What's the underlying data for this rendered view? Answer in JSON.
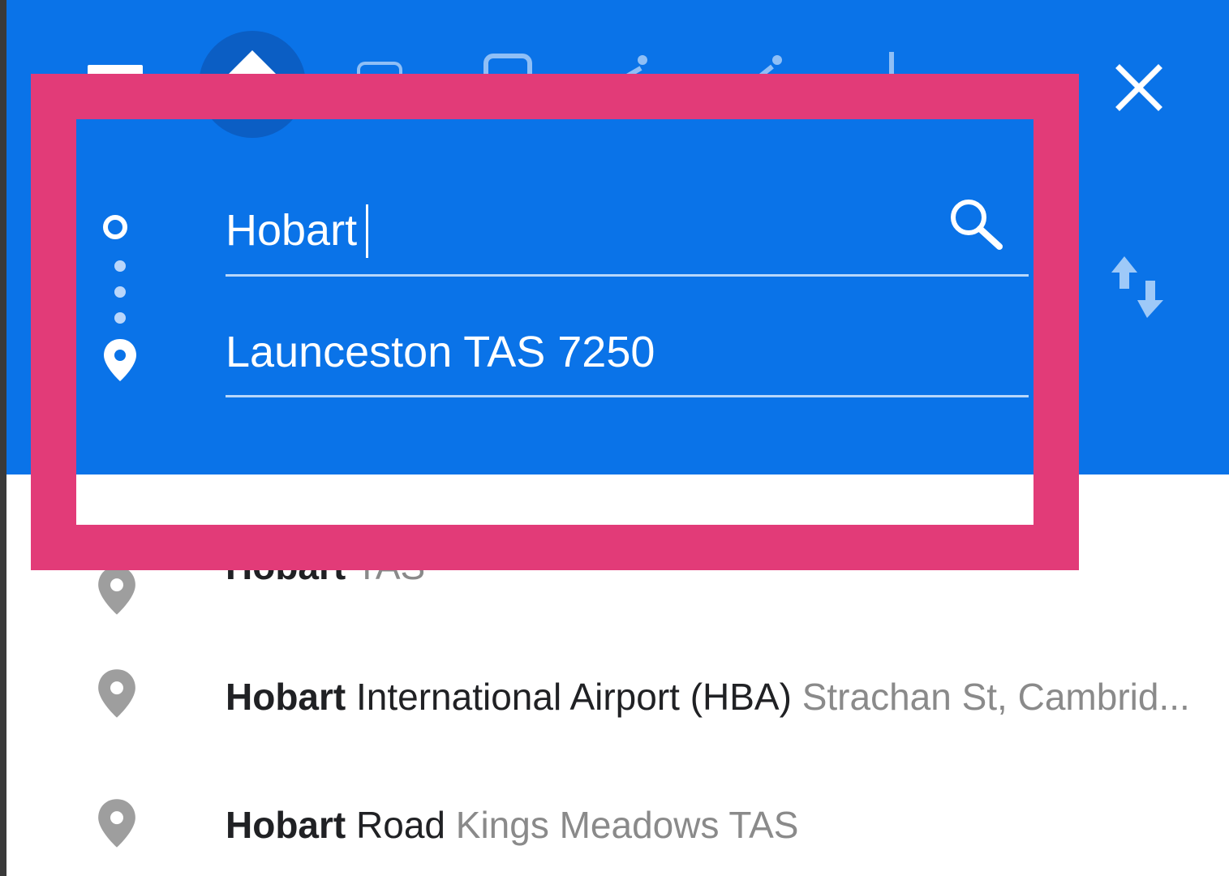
{
  "directions": {
    "origin_value": "Hobart",
    "destination_value": "Launceston TAS 7250"
  },
  "suggestions": [
    {
      "bold": "Hobart",
      "main": "",
      "sub": "TAS"
    },
    {
      "bold": "Hobart",
      "main": "International Airport (HBA)",
      "sub": "Strachan St, Cambrid..."
    },
    {
      "bold": "Hobart",
      "main": "Road",
      "sub": "Kings Meadows TAS"
    }
  ],
  "colors": {
    "header_blue": "#0a73e8",
    "highlight_pink": "#e23b78",
    "pin_gray": "#9e9e9e"
  },
  "icons": {
    "close": "close-icon",
    "swap": "swap-icon",
    "search": "search-icon",
    "origin": "origin-circle-icon",
    "destination": "destination-pin-icon"
  }
}
